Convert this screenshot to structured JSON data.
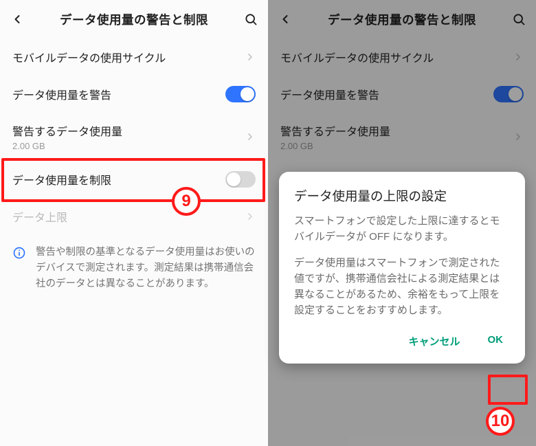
{
  "header": {
    "title": "データ使用量の警告と制限"
  },
  "rows": {
    "cycle": {
      "label": "モバイルデータの使用サイクル"
    },
    "warn": {
      "label": "データ使用量を警告"
    },
    "warnAmount": {
      "label": "警告するデータ使用量",
      "sub": "2.00 GB"
    },
    "limitToggle": {
      "label": "データ使用量を制限"
    },
    "limit": {
      "label": "データ上限"
    }
  },
  "info": {
    "text": "警告や制限の基準となるデータ使用量はお使いのデバイスで測定されます。測定結果は携帯通信会社のデータとは異なることがあります。"
  },
  "dialog": {
    "title": "データ使用量の上限の設定",
    "p1": "スマートフォンで設定した上限に達するとモバイルデータが OFF になります。",
    "p2": "データ使用量はスマートフォンで測定された値ですが、携帯通信会社による測定結果とは異なることがあるため、余裕をもって上限を設定することをおすすめします。",
    "cancel": "キャンセル",
    "ok": "OK"
  },
  "steps": {
    "nine": "9",
    "ten": "10"
  }
}
